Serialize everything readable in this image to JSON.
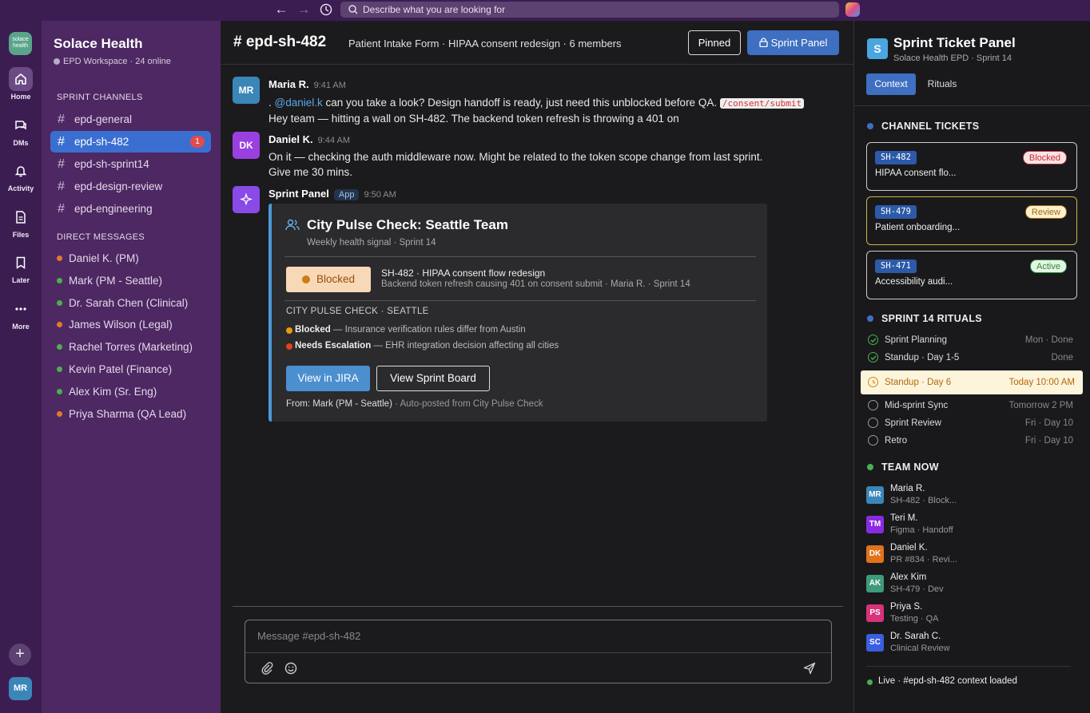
{
  "topbar": {
    "search_placeholder": "Describe what you are looking for"
  },
  "rail": {
    "logo_text": "solace health",
    "items": [
      {
        "label": "Home"
      },
      {
        "label": "DMs"
      },
      {
        "label": "Activity"
      },
      {
        "label": "Files"
      },
      {
        "label": "Later"
      },
      {
        "label": "More"
      }
    ],
    "add": "+",
    "me": "MR"
  },
  "sidebar": {
    "workspace": "Solace Health",
    "status": "EPD Workspace · 24 online",
    "channels_title": "SPRINT CHANNELS",
    "channels": [
      {
        "name": "epd-general"
      },
      {
        "name": "epd-sh-482",
        "badge": "1"
      },
      {
        "name": "epd-sh-sprint14"
      },
      {
        "name": "epd-design-review"
      },
      {
        "name": "epd-engineering"
      }
    ],
    "dms_title": "DIRECT MESSAGES",
    "dms": [
      {
        "name": "Daniel K. (PM)",
        "color": "#e07b2a"
      },
      {
        "name": "Mark (PM - Seattle)",
        "color": "#4caf50"
      },
      {
        "name": "Dr. Sarah Chen (Clinical)",
        "color": "#4caf50"
      },
      {
        "name": "James Wilson (Legal)",
        "color": "#e07b2a"
      },
      {
        "name": "Rachel Torres (Marketing)",
        "color": "#4caf50"
      },
      {
        "name": "Kevin Patel (Finance)",
        "color": "#4caf50"
      },
      {
        "name": "Alex Kim (Sr. Eng)",
        "color": "#4caf50"
      },
      {
        "name": "Priya Sharma (QA Lead)",
        "color": "#e07b2a"
      }
    ]
  },
  "header": {
    "hash": "#",
    "channel": "epd-sh-482",
    "description": "Patient Intake Form · HIPAA consent redesign · 6 members",
    "pinned": "Pinned",
    "sprint_panel": "Sprint Panel"
  },
  "messages": [
    {
      "initials": "MR",
      "color": "#3b86b8",
      "author": "Maria R.",
      "time": "9:41 AM",
      "line1_prefix": ". ",
      "mention": "@daniel.k",
      "line1_text": " can you take a look? Design handoff is ready, just need this unblocked before QA. ",
      "code": "/consent/submit",
      "line2": "Hey team — hitting a wall on SH-482. The backend token refresh is throwing a 401 on"
    },
    {
      "initials": "DK",
      "color": "#9b40e0",
      "author": "Daniel K.",
      "time": "9:44 AM",
      "line1": "On it — checking the auth middleware now. Might be related to the token scope change from last sprint.",
      "line2": "Give me 30 mins."
    },
    {
      "author": "Sprint Panel",
      "tag": "App",
      "time": "9:50 AM",
      "color": "#8a4ae8"
    }
  ],
  "card": {
    "title": "City Pulse Check: Seattle Team",
    "subtitle": "Weekly health signal · Sprint 14",
    "status": "Blocked",
    "ticket_line": "SH-482 · HIPAA consent flow redesign",
    "ticket_detail": "Backend token refresh causing 401 on consent submit · Maria R. ·  Sprint 14",
    "section": "CITY PULSE CHECK · SEATTLE",
    "items": [
      {
        "label": "Blocked",
        "text": " — Insurance verification rules differ from Austin",
        "color": "#e89a10"
      },
      {
        "label": "Needs Escalation",
        "text": " — EHR integration decision affecting all cities",
        "color": "#e0421a"
      }
    ],
    "btn_jira": "View in JIRA",
    "btn_board": "View Sprint Board",
    "from_label": "From: Mark (PM - Seattle)",
    "from_rest": " · Auto-posted from City Pulse Check"
  },
  "composer": {
    "placeholder": "Message #epd-sh-482"
  },
  "panel": {
    "logo": "S",
    "title": "Sprint Ticket Panel",
    "subtitle": "Solace Health EPD · Sprint 14",
    "tabs": [
      "Context",
      "Rituals"
    ],
    "tickets_title": "CHANNEL TICKETS",
    "tickets": [
      {
        "id": "SH-482",
        "status": "Blocked",
        "text": "HIPAA consent flo...",
        "border": "#cccccc",
        "st_bg": "#fbe3e3",
        "st_color": "#c0303a"
      },
      {
        "id": "SH-479",
        "status": "Review",
        "text": "Patient onboarding...",
        "border": "#c9b84a",
        "st_bg": "#fdf0d0",
        "st_color": "#a06a08"
      },
      {
        "id": "SH-471",
        "status": "Active",
        "text": "Accessibility audi...",
        "border": "#cccccc",
        "st_bg": "#e3f6e3",
        "st_color": "#2e8a3a"
      }
    ],
    "rituals_title": "SPRINT 14 RITUALS",
    "rituals": [
      {
        "name": "Sprint Planning",
        "when": "Mon · Done",
        "state": "done"
      },
      {
        "name": "Standup · Day 1-5",
        "when": "Done",
        "state": "done"
      },
      {
        "name": "Standup · Day 6",
        "when": "Today 10:00 AM",
        "state": "now"
      },
      {
        "name": "Mid-sprint Sync",
        "when": "Tomorrow 2 PM",
        "state": "todo"
      },
      {
        "name": "Sprint Review",
        "when": "Fri · Day 10",
        "state": "todo"
      },
      {
        "name": "Retro",
        "when": "Fri · Day 10",
        "state": "todo"
      }
    ],
    "team_title": "TEAM NOW",
    "team": [
      {
        "initials": "MR",
        "name": "Maria R.",
        "status": "SH-482 · Block...",
        "color": "#3b86b8"
      },
      {
        "initials": "TM",
        "name": "Teri M.",
        "status": "Figma · Handoff",
        "color": "#8a2be2"
      },
      {
        "initials": "DK",
        "name": "Daniel K.",
        "status": "PR #834 · Revi...",
        "color": "#e0731a"
      },
      {
        "initials": "AK",
        "name": "Alex Kim",
        "status": "SH-479 · Dev",
        "color": "#3f9a7a"
      },
      {
        "initials": "PS",
        "name": "Priya S.",
        "status": "Testing · QA",
        "color": "#d6337a"
      },
      {
        "initials": "SC",
        "name": "Dr. Sarah C.",
        "status": "Clinical Review",
        "color": "#3a5ee0"
      }
    ],
    "live": "Live · #epd-sh-482 context loaded"
  }
}
